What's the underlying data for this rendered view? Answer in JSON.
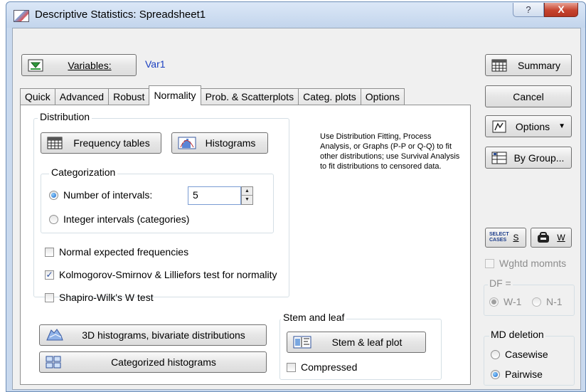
{
  "window": {
    "title": "Descriptive Statistics: Spreadsheet1",
    "help_label": "?",
    "close_label": "X"
  },
  "variables": {
    "button_label": "Variables:",
    "value": "Var1"
  },
  "tabs": [
    {
      "label": "Quick"
    },
    {
      "label": "Advanced"
    },
    {
      "label": "Robust"
    },
    {
      "label": "Normality",
      "active": true
    },
    {
      "label": "Prob. & Scatterplots"
    },
    {
      "label": "Categ. plots"
    },
    {
      "label": "Options"
    }
  ],
  "distribution": {
    "group_label": "Distribution",
    "frequency_tables": "Frequency tables",
    "histograms": "Histograms",
    "note": "Use Distribution Fitting, Process Analysis, or Graphs (P-P or Q-Q) to fit other distributions; use Survival Analysis to fit distributions to censored data."
  },
  "categorization": {
    "group_label": "Categorization",
    "number_of_intervals_label": "Number of intervals:",
    "number_of_intervals_value": "5",
    "integer_intervals_label": "Integer intervals (categories)",
    "selected": "number_of_intervals"
  },
  "options": {
    "normal_expected": {
      "label": "Normal expected frequencies",
      "checked": false
    },
    "ks_lilliefors": {
      "label": "Kolmogorov-Smirnov & Lilliefors test for normality",
      "checked": true
    },
    "shapiro_wilk": {
      "label": "Shapiro-Wilk's W test",
      "checked": false
    }
  },
  "bottom_buttons": {
    "histograms_3d": "3D histograms, bivariate distributions",
    "categorized_histograms": "Categorized histograms"
  },
  "stem_and_leaf": {
    "group_label": "Stem and leaf",
    "plot_button": "Stem & leaf plot",
    "compressed": {
      "label": "Compressed",
      "checked": false
    }
  },
  "sidebar": {
    "summary": "Summary",
    "cancel": "Cancel",
    "options": "Options",
    "by_group": "By Group...",
    "select_cases_icon_text": "SELECT CASES",
    "select_cases_label": "S",
    "weight_label": "W",
    "wghtd_momnts": {
      "label": "Wghtd momnts",
      "checked": false,
      "disabled": true
    },
    "df_group_label": "DF =",
    "df_options": [
      {
        "label": "W-1",
        "selected": true
      },
      {
        "label": "N-1",
        "selected": false
      }
    ],
    "md_deletion_label": "MD deletion",
    "md_options": [
      {
        "label": "Casewise",
        "selected": false
      },
      {
        "label": "Pairwise",
        "selected": true
      }
    ]
  }
}
